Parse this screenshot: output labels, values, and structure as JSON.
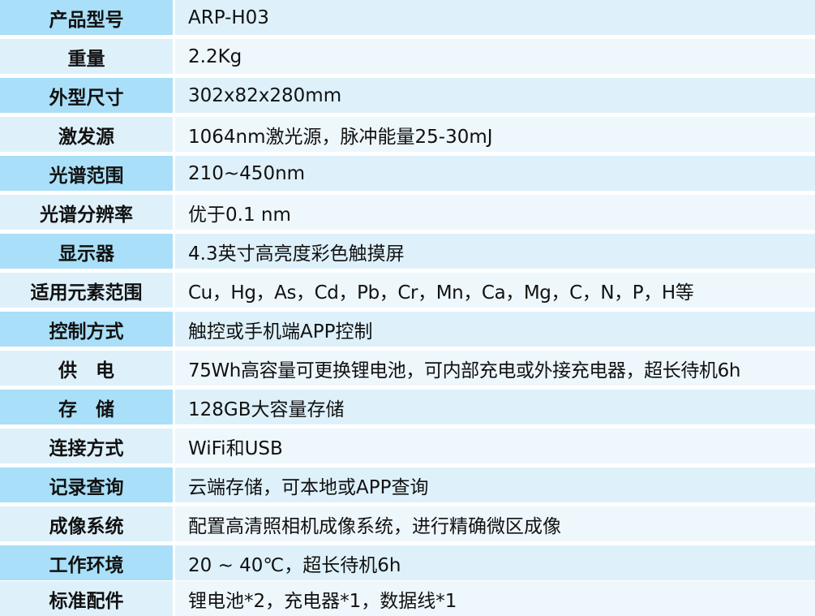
{
  "colors": {
    "label_dark": "#a9dff8",
    "label_light": "#def1fb",
    "value_dark": "#def1fb",
    "value_light": "#eef7fc",
    "text": "#111111"
  },
  "specs": [
    {
      "label": "产品型号",
      "value": "ARP-H03"
    },
    {
      "label": "重量",
      "value": "2.2Kg"
    },
    {
      "label": "外型尺寸",
      "value": "302x82x280mm"
    },
    {
      "label": "激发源",
      "value": "1064nm激光源，脉冲能量25-30mJ"
    },
    {
      "label": "光谱范围",
      "value": "210~450nm"
    },
    {
      "label": "光谱分辨率",
      "value": "优于0.1 nm"
    },
    {
      "label": "显示器",
      "value": "4.3英寸高亮度彩色触摸屏"
    },
    {
      "label": "适用元素范围",
      "value": "Cu，Hg，As，Cd，Pb，Cr，Mn，Ca，Mg，C，N，P，H等"
    },
    {
      "label": "控制方式",
      "value": "触控或手机端APP控制"
    },
    {
      "label": "供　电",
      "value": "75Wh高容量可更换锂电池，可内部充电或外接充电器，超长待机6h"
    },
    {
      "label": "存　储",
      "value": "128GB大容量存储"
    },
    {
      "label": "连接方式",
      "value": "WiFi和USB"
    },
    {
      "label": "记录查询",
      "value": "云端存储，可本地或APP查询"
    },
    {
      "label": "成像系统",
      "value": "配置高清照相机成像系统，进行精确微区成像"
    },
    {
      "label": "工作环境",
      "value": "20 ~ 40℃，超长待机6h"
    },
    {
      "label": "标准配件",
      "value": "锂电池*2，充电器*1，数据线*1"
    }
  ]
}
